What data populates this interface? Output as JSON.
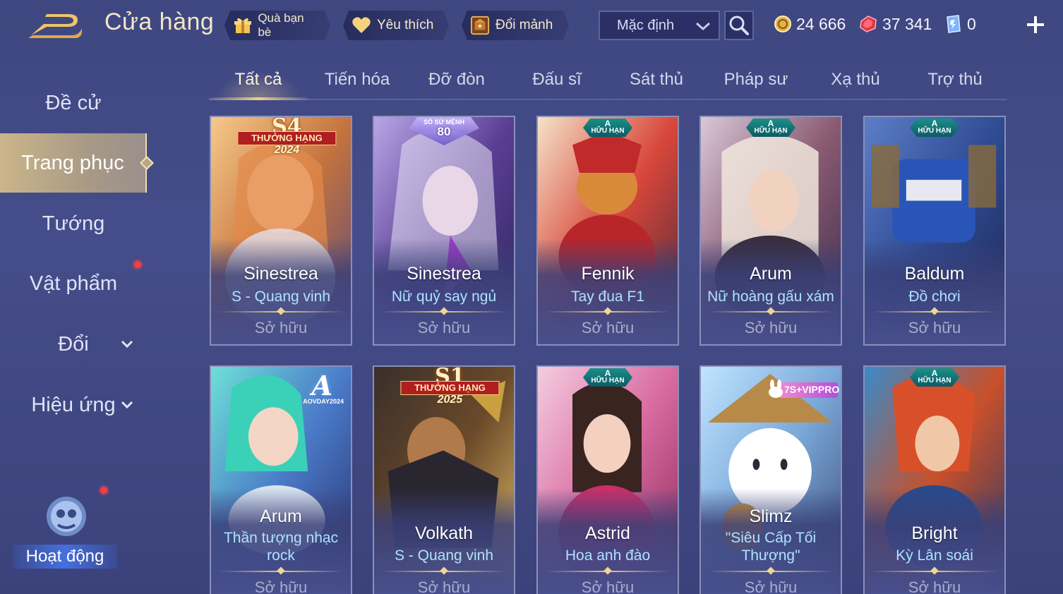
{
  "header": {
    "title": "Cửa hàng",
    "gift_label": "Quà bạn bè",
    "favorite_label": "Yêu thích",
    "shard_label": "Đổi mảnh",
    "sort_value": "Mặc định"
  },
  "currency": {
    "gold": "24 666",
    "voucher": "37 341",
    "ticket": "0"
  },
  "sidebar": {
    "items": [
      {
        "label": "Đề cử"
      },
      {
        "label": "Trang phục"
      },
      {
        "label": "Tướng"
      },
      {
        "label": "Vật phẩm"
      },
      {
        "label": "Đổi"
      },
      {
        "label": "Hiệu ứng"
      }
    ],
    "event_label": "Hoạt động"
  },
  "tabs": [
    {
      "label": "Tất cả"
    },
    {
      "label": "Tiến hóa"
    },
    {
      "label": "Đỡ đòn"
    },
    {
      "label": "Đấu sĩ"
    },
    {
      "label": "Sát thủ"
    },
    {
      "label": "Pháp sư"
    },
    {
      "label": "Xạ thủ"
    },
    {
      "label": "Trợ thủ"
    }
  ],
  "cards": [
    {
      "hero": "Sinestrea",
      "skin": "S - Quang vinh",
      "status": "Sở hữu",
      "badge_s": "S4",
      "badge_ribbon": "THƯỞNG HẠNG",
      "badge_year": "2024"
    },
    {
      "hero": "Sinestrea",
      "skin": "Nữ quỷ say ngủ",
      "status": "Sở hữu",
      "badge_label": "SỔ SỨ MỆNH",
      "badge_number": "80"
    },
    {
      "hero": "Fennik",
      "skin": "Tay đua F1",
      "status": "Sở hữu",
      "badge_a": "A",
      "badge_text": "HỮU HẠN"
    },
    {
      "hero": "Arum",
      "skin": "Nữ hoàng gấu xám",
      "status": "Sở hữu",
      "badge_a": "A",
      "badge_text": "HỮU HẠN"
    },
    {
      "hero": "Baldum",
      "skin": "Đồ chơi",
      "status": "Sở hữu",
      "badge_a": "A",
      "badge_text": "HỮU HẠN"
    },
    {
      "hero": "Arum",
      "skin": "Thần tượng nhạc rock",
      "status": "Sở hữu",
      "badge_a": "A",
      "badge_text": "AOVDAY2024"
    },
    {
      "hero": "Volkath",
      "skin": "S - Quang vinh",
      "status": "Sở hữu",
      "badge_s": "S1",
      "badge_ribbon": "THƯỞNG HẠNG",
      "badge_year": "2025"
    },
    {
      "hero": "Astrid",
      "skin": "Hoa anh đào",
      "status": "Sở hữu",
      "badge_a": "A",
      "badge_text": "HỮU HẠN"
    },
    {
      "hero": "Slimz",
      "skin": "\"Siêu Cấp Tối Thượng\"",
      "status": "Sở hữu",
      "badge_text": "7S+VIPPRO"
    },
    {
      "hero": "Bright",
      "skin": "Kỳ Lân soái",
      "status": "Sở hữu",
      "badge_a": "A",
      "badge_text": "HỮU HẠN"
    }
  ],
  "colors": {
    "background": "#434b86",
    "accent_gold": "#f0d28c",
    "skin_name": "#aee3ff",
    "notification": "#ff3b3b"
  }
}
